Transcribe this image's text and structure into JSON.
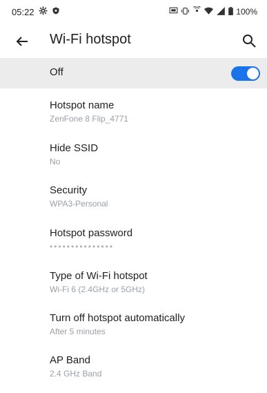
{
  "status": {
    "time": "05:22",
    "battery": "100%"
  },
  "header": {
    "title": "Wi-Fi hotspot"
  },
  "master": {
    "label": "Off",
    "toggle_on": true
  },
  "settings": [
    {
      "title": "Hotspot name",
      "value": "ZenFone 8 Flip_4771"
    },
    {
      "title": "Hide SSID",
      "value": "No"
    },
    {
      "title": "Security",
      "value": "WPA3-Personal"
    },
    {
      "title": "Hotspot password",
      "value": "•••••••••••••••"
    },
    {
      "title": "Type of Wi-Fi hotspot",
      "value": "Wi-Fi 6 (2.4GHz or 5GHz)"
    },
    {
      "title": "Turn off hotspot automatically",
      "value": "After 5 minutes"
    },
    {
      "title": "AP Band",
      "value": "2.4 GHz Band"
    }
  ],
  "colors": {
    "accent": "#1a73e8",
    "toggle_row_bg": "#ececec"
  }
}
